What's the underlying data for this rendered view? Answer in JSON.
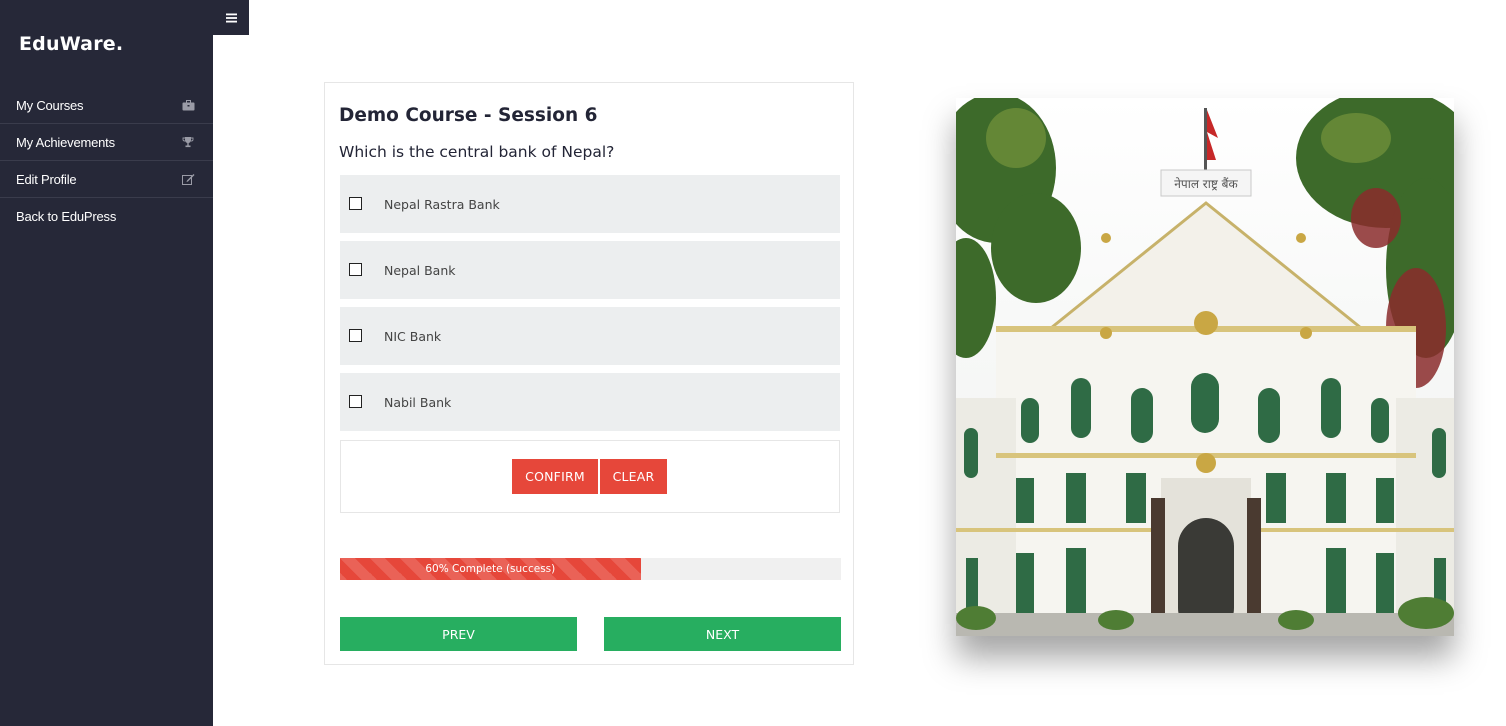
{
  "sidebar": {
    "logo": "EduWare.",
    "items": [
      {
        "label": "My Courses",
        "icon": "briefcase-icon"
      },
      {
        "label": "My Achievements",
        "icon": "trophy-icon"
      },
      {
        "label": "Edit Profile",
        "icon": "edit-icon"
      },
      {
        "label": "Back to EduPress",
        "icon": ""
      }
    ]
  },
  "toggle": {
    "icon": "hamburger-menu-icon"
  },
  "quiz": {
    "title": "Demo Course - Session 6",
    "question": "Which is the central bank of Nepal?",
    "options": [
      {
        "label": "Nepal Rastra Bank",
        "checked": false
      },
      {
        "label": "Nepal Bank",
        "checked": false
      },
      {
        "label": "NIC Bank",
        "checked": false
      },
      {
        "label": "Nabil Bank",
        "checked": false
      }
    ],
    "confirm_label": "CONFIRM",
    "clear_label": "CLEAR",
    "progress": {
      "percent": 60,
      "label": "60% Complete (success)"
    },
    "prev_label": "PREV",
    "next_label": "NEXT"
  },
  "image": {
    "subject": "Nepal Rastra Bank building photo",
    "sign_text": "नेपाल राष्ट्र बैंक"
  },
  "colors": {
    "sidebar_bg": "#262838",
    "accent_red": "#e6473a",
    "accent_green": "#27ae60",
    "option_bg": "#eceeef"
  }
}
